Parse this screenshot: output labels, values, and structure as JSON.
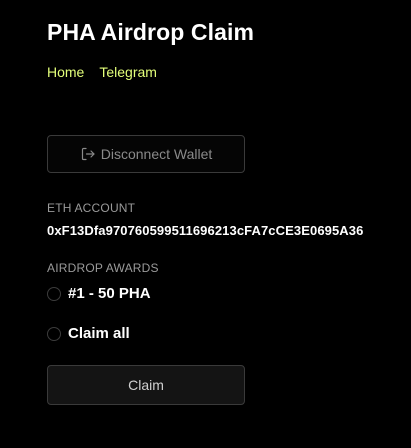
{
  "header": {
    "title": "PHA Airdrop Claim"
  },
  "nav": {
    "links": [
      {
        "label": "Home"
      },
      {
        "label": "Telegram"
      }
    ]
  },
  "wallet": {
    "disconnect_label": "Disconnect Wallet",
    "disconnect_icon": "logout-icon"
  },
  "account": {
    "label": "ETH ACCOUNT",
    "address": "0xF13Dfa97076059951169 6213cFA7cCE3E0695A36"
  },
  "awards": {
    "label": "AIRDROP AWARDS",
    "options": [
      {
        "label": "#1 - 50 PHA",
        "selected": false
      },
      {
        "label": "Claim all",
        "selected": false
      }
    ]
  },
  "actions": {
    "claim_label": "Claim"
  },
  "colors": {
    "background": "#000000",
    "nav_link": "#e3ff7a",
    "muted_text": "#9a9a9a"
  }
}
